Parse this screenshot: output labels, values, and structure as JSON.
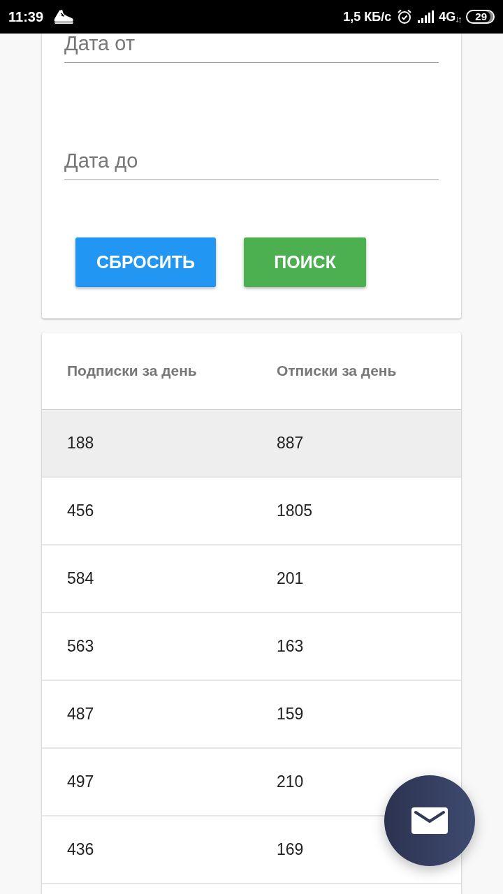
{
  "status_bar": {
    "time": "11:39",
    "net_speed": "1,5 КБ/с",
    "network": "4G",
    "battery": "29"
  },
  "filters": {
    "fields": [
      {
        "placeholder": "Дата от"
      },
      {
        "placeholder": "Дата до"
      }
    ],
    "buttons": [
      {
        "label": "СБРОСИТЬ",
        "kind": "reset"
      },
      {
        "label": "ПОИСК",
        "kind": "search"
      }
    ]
  },
  "table": {
    "columns": [
      "Подписки за день",
      "Отписки за день"
    ],
    "rows": [
      {
        "cells": [
          "188",
          "887"
        ],
        "selected": true
      },
      {
        "cells": [
          "456",
          "1805"
        ],
        "selected": false
      },
      {
        "cells": [
          "584",
          "201"
        ],
        "selected": false
      },
      {
        "cells": [
          "563",
          "163"
        ],
        "selected": false
      },
      {
        "cells": [
          "487",
          "159"
        ],
        "selected": false
      },
      {
        "cells": [
          "497",
          "210"
        ],
        "selected": false
      },
      {
        "cells": [
          "436",
          "169"
        ],
        "selected": false
      }
    ]
  }
}
